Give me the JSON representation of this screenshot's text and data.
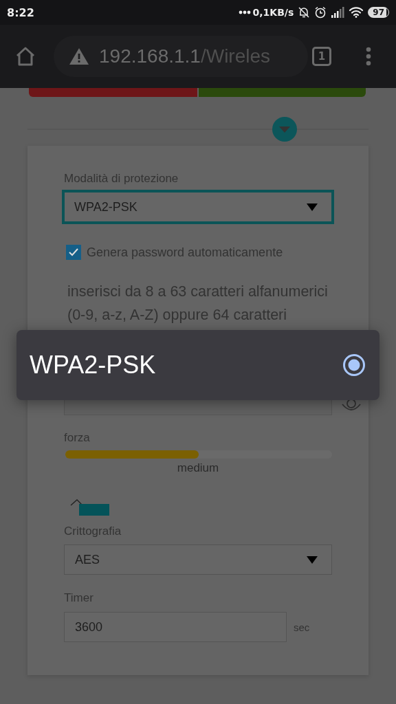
{
  "status_bar": {
    "time": "8:22",
    "network_speed": "0,1KB/s",
    "battery": "97"
  },
  "browser": {
    "url_host": "192.168.1.1",
    "url_path": "/Wireles",
    "tab_count": "1"
  },
  "form": {
    "protection_mode": {
      "label": "Modalità di protezione",
      "value": "WPA2-PSK"
    },
    "auto_password": {
      "label": "Genera password automaticamente",
      "checked": true
    },
    "hint": "inserisci da 8 a 63 caratteri alfanumerici (0-9, a-z, A-Z) oppure 64 caratteri",
    "strength": {
      "label": "forza",
      "level": 0.5,
      "reading": "medium"
    },
    "encryption": {
      "label": "Crittografia",
      "value": "AES"
    },
    "timer": {
      "label": "Timer",
      "value": "3600",
      "unit": "sec"
    }
  },
  "dialog": {
    "options": [
      {
        "label": "WPA2-PSK",
        "selected": true
      }
    ]
  }
}
